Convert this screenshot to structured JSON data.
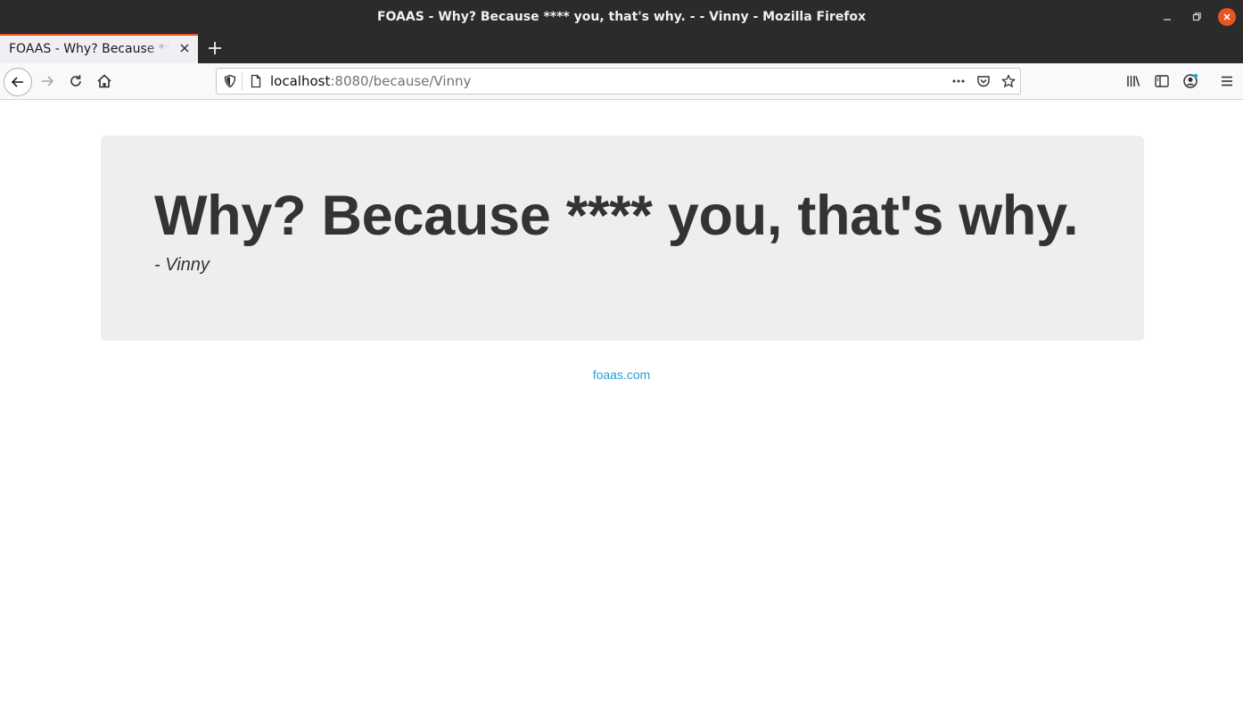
{
  "window": {
    "title": "FOAAS - Why? Because **** you, that's why. - - Vinny - Mozilla Firefox"
  },
  "tabs": [
    {
      "label": "FOAAS - Why? Because **** you, that's why.",
      "active": true
    }
  ],
  "urlbar": {
    "host": "localhost",
    "path": ":8080/because/Vinny"
  },
  "page": {
    "heading": "Why? Because **** you, that's why.",
    "subtitle": "- Vinny",
    "footer_link": "foaas.com"
  },
  "colors": {
    "accent": "#e95420",
    "hero_bg": "#eeeeee",
    "text": "#333333",
    "link": "#2a9fd6"
  },
  "icons": [
    "back-icon",
    "forward-icon",
    "reload-icon",
    "home-icon",
    "shield-icon",
    "page-icon",
    "more-icon",
    "pocket-icon",
    "star-icon",
    "library-icon",
    "sidebar-icon",
    "account-icon",
    "menu-icon",
    "plus-icon",
    "close-icon"
  ]
}
